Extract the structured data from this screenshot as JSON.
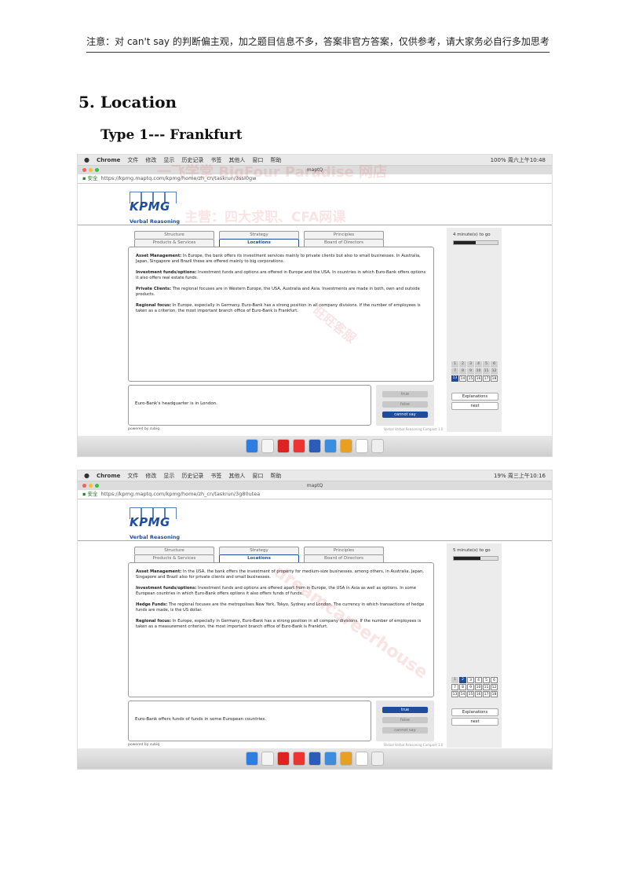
{
  "header_note": "注意：对 can't say 的判断偏主观，加之题目信息不多，答案非官方答案，仅供参考，请大家务必自行多加思考",
  "section_title": "5. Location",
  "type_title": "Type 1--- Frankfurt",
  "watermarks": [
    "一飞学堂 BigFour Paradise 网店",
    "主营：四大求职、CFA网课",
    "旺旺客服",
    "dreamcareerhouse"
  ],
  "screenshots": [
    {
      "menubar": {
        "app": "Chrome",
        "menus": [
          "文件",
          "修改",
          "显示",
          "历史记录",
          "书签",
          "其他人",
          "窗口",
          "帮助"
        ],
        "status": "100% 周六上午10:48"
      },
      "window_title": "maptQ",
      "url_secure": "安全",
      "url": "https://kpmg.maptq.com/kpmg/home/zh_cn/taskrun/3ssI0gw",
      "logo_text": "KPMG",
      "section_label": "Verbal Reasoning",
      "tabs_top": [
        "Structure",
        "Strategy",
        "Principles"
      ],
      "tabs_bottom": [
        "Products & Services",
        "Locations",
        "Board of Directors"
      ],
      "passage": [
        {
          "label": "Asset Management:",
          "text": " In Europe, the bank offers its investment services mainly to private clients but also to small businesses. In Australia, Japan, Singapore and Brazil these are offered mainly to big corporations."
        },
        {
          "label": "Investment funds/options:",
          "text": " Investment funds and options are offered in Europe and the USA. In countries in which Euro-Bank offers options it also offers real estate funds."
        },
        {
          "label": "Private Clients:",
          "text": " The regional focuses are in Western Europe, the USA, Australia and Asia. Investments are made in both, own and outside products."
        },
        {
          "label": "Regional focus:",
          "text": " In Europe, especially in Germany. Euro-Bank has a strong position in all company divisions. If the number of employees is taken as a criterion, the most important branch office of Euro-Bank is Frankfurt."
        }
      ],
      "statement": "Euro-Bank's headquarter is in London.",
      "answers": [
        "true",
        "false",
        "cannot say"
      ],
      "selected_answer": "cannot say",
      "timer": "4 minute(s) to go",
      "timer_remaining": 0.5,
      "questions": [
        "1",
        "2",
        "3",
        "4",
        "5",
        "6",
        "7",
        "8",
        "9",
        "10",
        "11",
        "12",
        "13",
        "14",
        "15",
        "16",
        "17",
        "18"
      ],
      "current_question": "13",
      "explanations_label": "Explanations",
      "next_label": "next",
      "powered_by": "powered by cubiq",
      "version": "Verbal Verbal Reasoning Compact 1.0"
    },
    {
      "menubar": {
        "app": "Chrome",
        "menus": [
          "文件",
          "修改",
          "显示",
          "历史记录",
          "书签",
          "其他人",
          "窗口",
          "帮助"
        ],
        "status": "19% 周三上午10:16"
      },
      "window_title": "maptQ",
      "url_secure": "安全",
      "url": "https://kpmg.maptq.com/kpmg/home/zh_cn/taskrun/3g80utea",
      "logo_text": "KPMG",
      "section_label": "Verbal Reasoning",
      "tabs_top": [
        "Structure",
        "Strategy",
        "Principles"
      ],
      "tabs_bottom": [
        "Products & Services",
        "Locations",
        "Board of Directors"
      ],
      "passage": [
        {
          "label": "Asset Management:",
          "text": " In the USA, the bank offers the investment of property for medium-size businesses, among others, in Australia, Japan, Singapore and Brazil also for private clients and small businesses."
        },
        {
          "label": "Investment funds/options:",
          "text": " Investment funds and options are offered apart from in Europe, the USA in Asia as well as options. In some European countries in which Euro-Bank offers options it also offers funds of funds."
        },
        {
          "label": "Hedge Funds:",
          "text": " The regional focuses are the metropolises New York, Tokyo, Sydney and London. The currency in which transactions of hedge funds are made, is the US dollar."
        },
        {
          "label": "Regional focus:",
          "text": " In Europe, especially in Germany, Euro-Bank has a strong position in all company divisions. If the number of employees is taken as a measurement criterion, the most important branch office of Euro-Bank is Frankfurt."
        }
      ],
      "statement": "Euro-Bank offers funds of funds in some European countries.",
      "answers": [
        "true",
        "false",
        "cannot say"
      ],
      "selected_answer": "true",
      "timer": "5 minute(s) to go",
      "timer_remaining": 0.6,
      "questions": [
        "1",
        "2",
        "3",
        "4",
        "5",
        "6",
        "7",
        "8",
        "9",
        "10",
        "11",
        "12",
        "13",
        "14",
        "15",
        "16",
        "17",
        "18"
      ],
      "current_question": "2",
      "explanations_label": "Explanations",
      "next_label": "next",
      "powered_by": "powered by cubiq",
      "version": "Verbal Verbal Reasoning Compact 1.0"
    }
  ],
  "colors": {
    "kpmg_blue": "#1f4d9b",
    "selected": "#1f4d9b",
    "watermark": "#dc3c3c"
  }
}
